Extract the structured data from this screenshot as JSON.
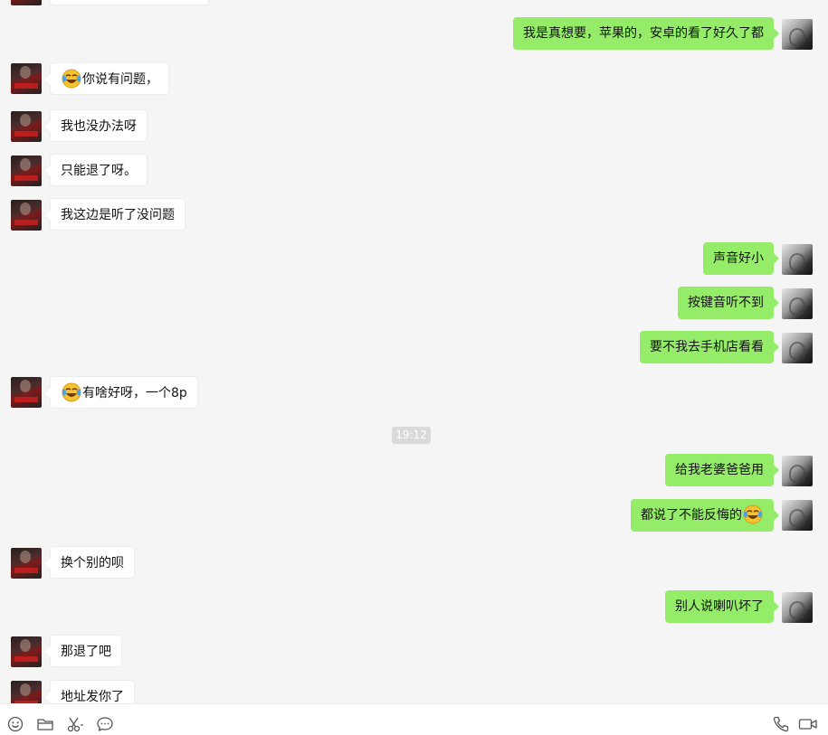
{
  "chat": {
    "cut_off_top_text": "",
    "timestamp": "19:12",
    "messages": [
      {
        "side": "self",
        "text": "我是真想要，苹果的，安卓的看了好久了都"
      },
      {
        "side": "other",
        "emoji": "face-with-tears-of-joy",
        "text": "你说有问题，"
      },
      {
        "side": "other",
        "text": "我也没办法呀"
      },
      {
        "side": "other",
        "text": "只能退了呀。"
      },
      {
        "side": "other",
        "text": "我这边是听了没问题"
      },
      {
        "side": "self",
        "text": "声音好小"
      },
      {
        "side": "self",
        "text": "按键音听不到"
      },
      {
        "side": "self",
        "text": "要不我去手机店看看"
      },
      {
        "side": "other",
        "emoji": "face-with-tears-of-joy",
        "text": "有啥好呀，一个8p"
      },
      {
        "side": "self",
        "text": "给我老婆爸爸用"
      },
      {
        "side": "self",
        "text": "都说了不能反悔的",
        "emoji_after": "face-with-tears-of-joy"
      },
      {
        "side": "other",
        "text": "换个别的呗"
      },
      {
        "side": "self",
        "text": "别人说喇叭坏了"
      },
      {
        "side": "other",
        "text": "那退了吧"
      },
      {
        "side": "other",
        "text": "地址发你了"
      }
    ]
  },
  "toolbar": {
    "left_tools": [
      "emoji-icon",
      "folder-icon",
      "scissors-icon",
      "chat-bubble-icon"
    ],
    "right_tools": [
      "phone-icon",
      "video-call-icon"
    ]
  },
  "colors": {
    "background": "#f5f5f5",
    "self_bubble": "#95ec69",
    "other_bubble": "#ffffff",
    "timestamp_bg": "#dadada"
  }
}
